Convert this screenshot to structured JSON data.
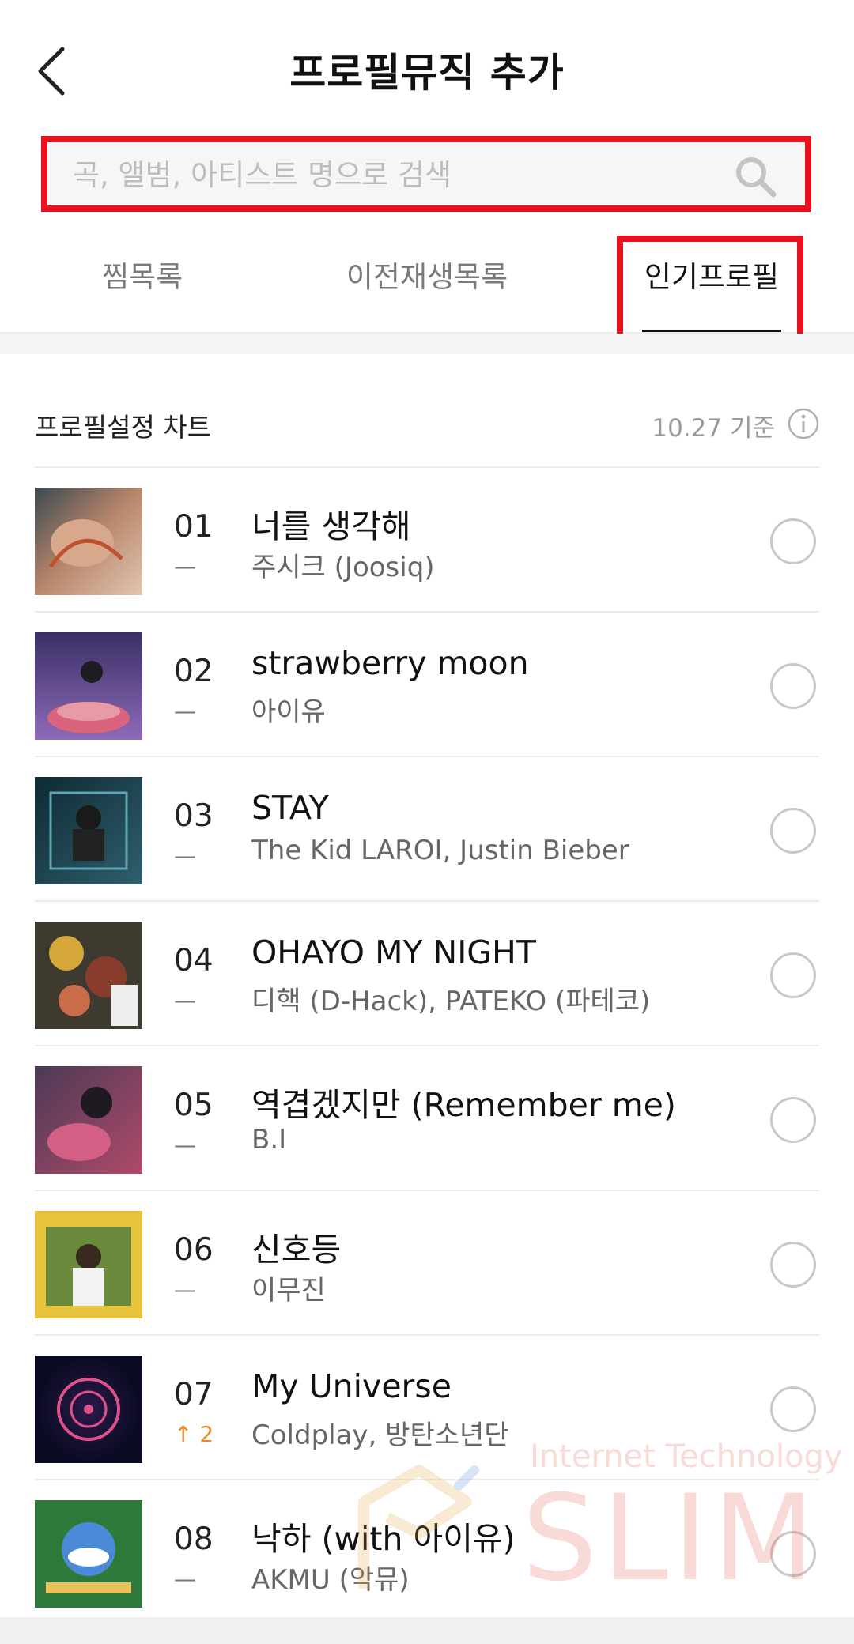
{
  "header": {
    "title": "프로필뮤직 추가"
  },
  "search": {
    "placeholder": "곡, 앨범, 아티스트 명으로 검색"
  },
  "tabs": [
    {
      "label": "찜목록",
      "active": false
    },
    {
      "label": "이전재생목록",
      "active": false
    },
    {
      "label": "인기프로필",
      "active": true
    }
  ],
  "chart": {
    "title": "프로필설정 차트",
    "date": "10.27 기준"
  },
  "songs": [
    {
      "rank": "01",
      "change": "—",
      "title": "너를 생각해",
      "artist": "주시크 (Joosiq)"
    },
    {
      "rank": "02",
      "change": "—",
      "title": "strawberry moon",
      "artist": "아이유"
    },
    {
      "rank": "03",
      "change": "—",
      "title": "STAY",
      "artist": "The Kid LAROI, Justin Bieber"
    },
    {
      "rank": "04",
      "change": "—",
      "title": "OHAYO MY NIGHT",
      "artist": "디핵 (D-Hack), PATEKO (파테코)"
    },
    {
      "rank": "05",
      "change": "—",
      "title": "역겹겠지만 (Remember me)",
      "artist": "B.I"
    },
    {
      "rank": "06",
      "change": "—",
      "title": "신호등",
      "artist": "이무진"
    },
    {
      "rank": "07",
      "change": "↑ 2",
      "title": "My Universe",
      "artist": "Coldplay, 방탄소년단"
    },
    {
      "rank": "08",
      "change": "—",
      "title": "낙하 (with 아이유)",
      "artist": "AKMU (악뮤)"
    }
  ],
  "watermark": {
    "small": "Internet Technology",
    "big": "SLIM"
  },
  "colors": {
    "highlight": "#e8111d",
    "rank_up": "#e68a2e"
  },
  "icons": {
    "back": "chevron-left-icon",
    "search": "search-icon",
    "info": "info-icon",
    "select": "radio-circle-icon"
  }
}
